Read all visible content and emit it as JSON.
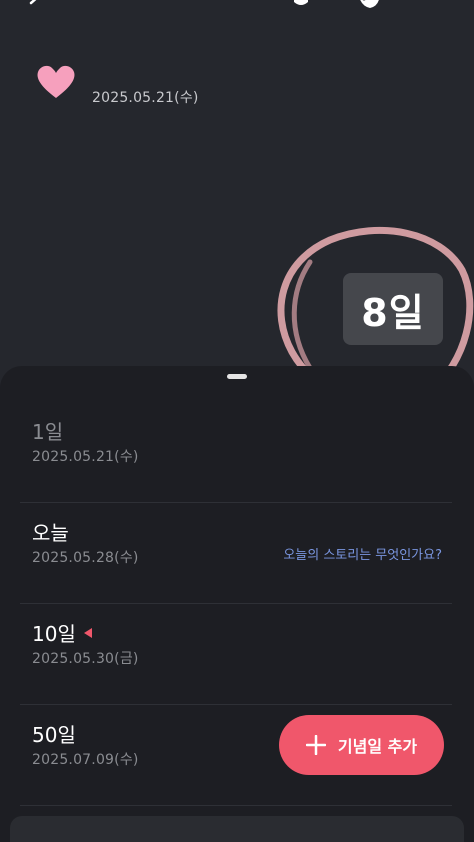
{
  "topbar": {
    "back_icon": "chevron-left-icon",
    "bell_icon": "bell-icon",
    "palette_icon": "palette-icon",
    "more_icon": "more-icon"
  },
  "header": {
    "heart_icon": "heart-icon",
    "start_date": "2025.05.21(수)",
    "dday_label": "8일",
    "heart_color": "#f6a0bd",
    "circle_color": "#d8a1a6"
  },
  "sheet": {
    "rows": [
      {
        "title": "1일",
        "date": "2025.05.21(수)"
      },
      {
        "title": "오늘",
        "date": "2025.05.28(수)",
        "story_link": "오늘의 스토리는 무엇인가요?"
      },
      {
        "title": "10일",
        "date": "2025.05.30(금)",
        "marker_icon": "marker-icon"
      },
      {
        "title": "50일",
        "date": "2025.07.09(수)"
      }
    ],
    "add_button": {
      "icon": "plus-icon",
      "label": "기념일 추가"
    }
  },
  "colors": {
    "background": "#25272d",
    "sheet": "#1d1e23",
    "accent": "#f0576b",
    "link": "#7a96e0"
  }
}
